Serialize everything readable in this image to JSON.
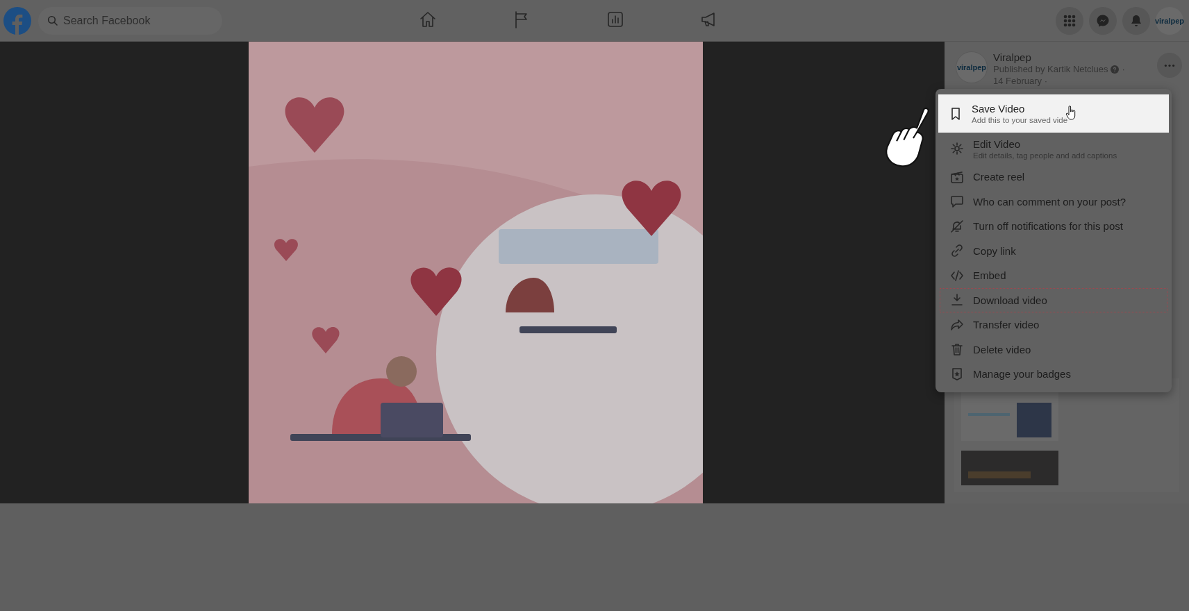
{
  "top_bar": {
    "search": {
      "placeholder": "Search Facebook"
    },
    "nav": [
      {
        "kind": "home",
        "selected": false
      },
      {
        "kind": "flag",
        "selected": false
      },
      {
        "kind": "chart",
        "selected": false
      },
      {
        "kind": "megaphone",
        "selected": false
      }
    ],
    "actions": [
      {
        "kind": "grid"
      },
      {
        "kind": "messenger"
      },
      {
        "kind": "bell"
      }
    ],
    "account": {
      "logo_text": "viralpep"
    }
  },
  "post": {
    "page_logo_text": "viralpep",
    "page_name": "Viralpep",
    "published_by": "Published by Kartik Netclues",
    "separator": "·",
    "date": "14 February ·"
  },
  "menu": {
    "items": [
      {
        "kind": "bookmark",
        "label": "Save Video",
        "description": "Add this to your saved vide",
        "highlighted": true,
        "outlined": false
      },
      {
        "kind": "gear",
        "label": "Edit Video",
        "description": "Edit details, tag people and add captions",
        "highlighted": false,
        "outlined": false
      },
      {
        "kind": "reel",
        "label": "Create reel",
        "highlighted": false,
        "outlined": false
      },
      {
        "kind": "comment",
        "label": "Who can comment on your post?",
        "highlighted": false,
        "outlined": false
      },
      {
        "kind": "bell-off",
        "label": "Turn off notifications for this post",
        "highlighted": false,
        "outlined": false
      },
      {
        "kind": "link",
        "label": "Copy link",
        "highlighted": false,
        "outlined": false
      },
      {
        "kind": "code",
        "label": "Embed",
        "highlighted": false,
        "outlined": false
      },
      {
        "kind": "download",
        "label": "Download video",
        "highlighted": false,
        "outlined": true
      },
      {
        "kind": "share",
        "label": "Transfer video",
        "highlighted": false,
        "outlined": false
      },
      {
        "kind": "trash",
        "label": "Delete video",
        "highlighted": false,
        "outlined": false
      },
      {
        "kind": "badge",
        "label": "Manage your badges",
        "highlighted": false,
        "outlined": false
      }
    ]
  }
}
